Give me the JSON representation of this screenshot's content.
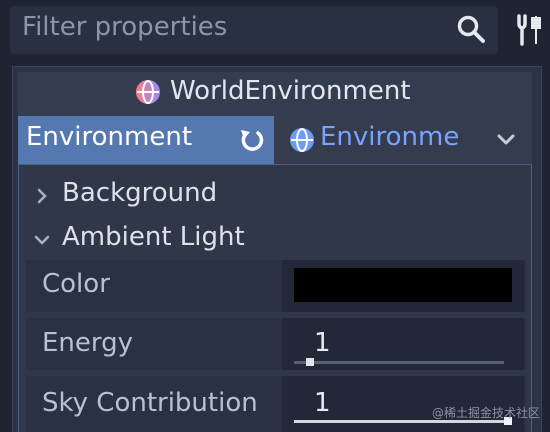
{
  "filter": {
    "placeholder": "Filter properties"
  },
  "icons": {
    "search": "search-icon",
    "tools": "tools-icon",
    "node": "world-environment-globe-icon",
    "reset": "reset-icon",
    "resource": "globe-icon",
    "dropdown": "chevron-down-icon"
  },
  "inspector": {
    "node_title": "WorldEnvironment",
    "property_label": "Environment",
    "resource_value": "Environme",
    "sections": [
      {
        "label": "Background",
        "expanded": false
      },
      {
        "label": "Ambient Light",
        "expanded": true
      }
    ],
    "properties": {
      "color": {
        "label": "Color",
        "value": "#000000"
      },
      "energy": {
        "label": "Energy",
        "value": "1",
        "fraction": 0.06
      },
      "sky_contribution": {
        "label": "Sky Contribution",
        "value": "1",
        "fraction": 1.0
      }
    }
  },
  "colors": {
    "selected_property": "#5678b0",
    "resource_text": "#7aa2ff",
    "panel": "#2b3344"
  },
  "watermark": "@稀土掘金技术社区"
}
